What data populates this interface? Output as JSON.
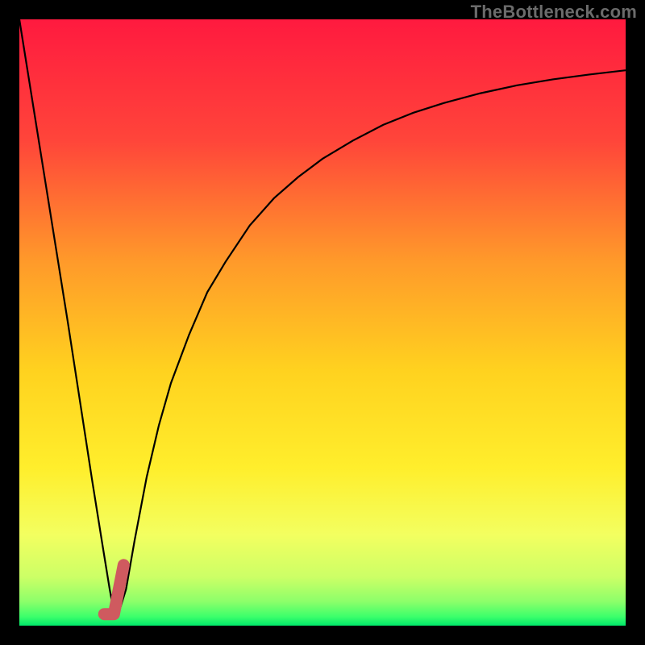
{
  "watermark": "TheBottleneck.com",
  "chart_data": {
    "type": "line",
    "title": "",
    "xlabel": "",
    "ylabel": "",
    "xlim": [
      0,
      100
    ],
    "ylim": [
      0,
      100
    ],
    "grid": false,
    "legend": false,
    "annotations": [],
    "series": [
      {
        "name": "bottleneck-curve",
        "x": [
          0,
          2,
          4,
          6,
          8,
          10,
          12,
          13.6,
          14.9,
          15.6,
          16.5,
          17.6,
          19,
          21,
          23,
          25,
          28,
          31,
          34,
          38,
          42,
          46,
          50,
          55,
          60,
          65,
          70,
          76,
          82,
          88,
          94,
          100
        ],
        "values": [
          100,
          87.5,
          75,
          62.5,
          50,
          37,
          24,
          14,
          6,
          2.2,
          2.5,
          6,
          14,
          24.5,
          33,
          40,
          48,
          55,
          60,
          66,
          70.5,
          74,
          77,
          80,
          82.6,
          84.6,
          86.2,
          87.8,
          89.1,
          90.1,
          90.9,
          91.6
        ]
      }
    ],
    "marker": {
      "name": "selected-range",
      "x_start": 14.0,
      "x_end": 17.2,
      "y_start": 1.9,
      "y_end": 10.0,
      "color": "#cf5a5f"
    },
    "background_gradient": {
      "top": "#ff1a3f",
      "upper_mid": "#ff8a2a",
      "mid": "#ffe12a",
      "lower_mid": "#f3ff60",
      "near_bottom": "#b8ff6e",
      "bottom": "#00e86a"
    }
  }
}
